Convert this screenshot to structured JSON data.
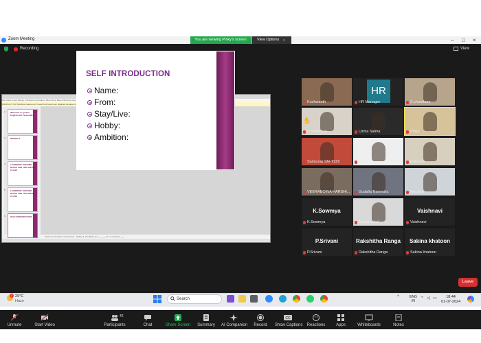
{
  "window": {
    "title": "Zoom Meeting",
    "banner": "You are viewing Pinky's screen",
    "view_options": "View Options"
  },
  "meeting": {
    "recording": "Recording",
    "view": "View"
  },
  "ppt": {
    "title": "Writing Speaking Abroad.pptx - PowerPoint",
    "ribbon": "File   Home   Insert   Design   Transitions   Animations   Slide Show   Record   Review   View   Help",
    "notice": "PRODUCT NOTICE  Most features in PowerPoint have been disabled because it hasn't been activated.",
    "notes": "Notes on formation of sentences - Hobby & of hobbies are ___ ___ the of of them's ___",
    "thumbs": [
      {
        "num": "2",
        "title": "Welcome to spoken English and Personality"
      },
      {
        "num": "3",
        "title": "RESPECT"
      },
      {
        "num": "4",
        "title": "LEARNERS' GROUND RULES FOR THE ONLINE CLASS"
      },
      {
        "num": "5",
        "title": "LEARNERS' GROUND RULES FOR THE ONLINE CLASS"
      },
      {
        "num": "6",
        "title": "SELF INTRODUCTION"
      }
    ],
    "slide": {
      "title": "SELF INTRODUCTION",
      "bullets": [
        "Name:",
        "From:",
        "Stay/Live:",
        "Hobby:",
        "Ambition:"
      ]
    }
  },
  "participants": [
    {
      "name": "Kushwanth",
      "kind": "video",
      "color": "#8a6a52"
    },
    {
      "name": "HR Manager",
      "kind": "logo",
      "logo": "HR"
    },
    {
      "name": "S.chandana",
      "kind": "video",
      "color": "#b7a48c"
    },
    {
      "name": "P. Srileshya",
      "kind": "video",
      "color": "#d8d2c8"
    },
    {
      "name": "Uzma Salma",
      "kind": "video",
      "color": "#2a2a2a"
    },
    {
      "name": "Pinky",
      "kind": "video",
      "color": "#d6c39a"
    },
    {
      "name": "Samsung SM-T225",
      "kind": "video",
      "color": "#c24a3a"
    },
    {
      "name": "Divya",
      "kind": "video",
      "color": "#efefef"
    },
    {
      "name": "Rahman",
      "kind": "video",
      "color": "#d7d0bf"
    },
    {
      "name": "VEERABOINA HARSHI...",
      "kind": "video",
      "color": "#7a6d60"
    },
    {
      "name": "Gudalla Narendra",
      "kind": "video",
      "color": "#6f7480"
    },
    {
      "name": "Varshini",
      "kind": "video",
      "color": "#cfd4d8"
    },
    {
      "name": "K.Sowmya",
      "kind": "text",
      "big": "K.Sowmya"
    },
    {
      "name": "Bunny.rahul",
      "kind": "video",
      "color": "#d9d9d9"
    },
    {
      "name": "Vaishnavi",
      "kind": "text",
      "big": "Vaishnavi"
    },
    {
      "name": "P.Srivani",
      "kind": "text",
      "big": "P.Srivani"
    },
    {
      "name": "Rakshitha Ranga",
      "kind": "text",
      "big": "Rakshitha Ranga"
    },
    {
      "name": "Sakina khatoon",
      "kind": "text",
      "big": "Sakina khatoon"
    }
  ],
  "toolbar": {
    "unmute": "Unmute",
    "start_video": "Start Video",
    "participants": "Participants",
    "participants_count": "42",
    "chat": "Chat",
    "share_screen": "Share Screen",
    "summary": "Summary",
    "ai_companion": "AI Companion",
    "record": "Record",
    "show_captions": "Show Captions",
    "reactions": "Reactions",
    "apps": "Apps",
    "whiteboards": "Whiteboards",
    "notes": "Notes",
    "leave": "Leave"
  },
  "taskbar": {
    "temp": "29°C",
    "weather": "Haze",
    "search": "Search",
    "lang1": "ENG",
    "lang2": "IN",
    "time": "18:44",
    "date": "01-07-2024",
    "weather_badge": "1"
  },
  "colors": {
    "accent": "#23a84e",
    "leave": "#d63030",
    "slide_purple": "#7b2c8c"
  }
}
